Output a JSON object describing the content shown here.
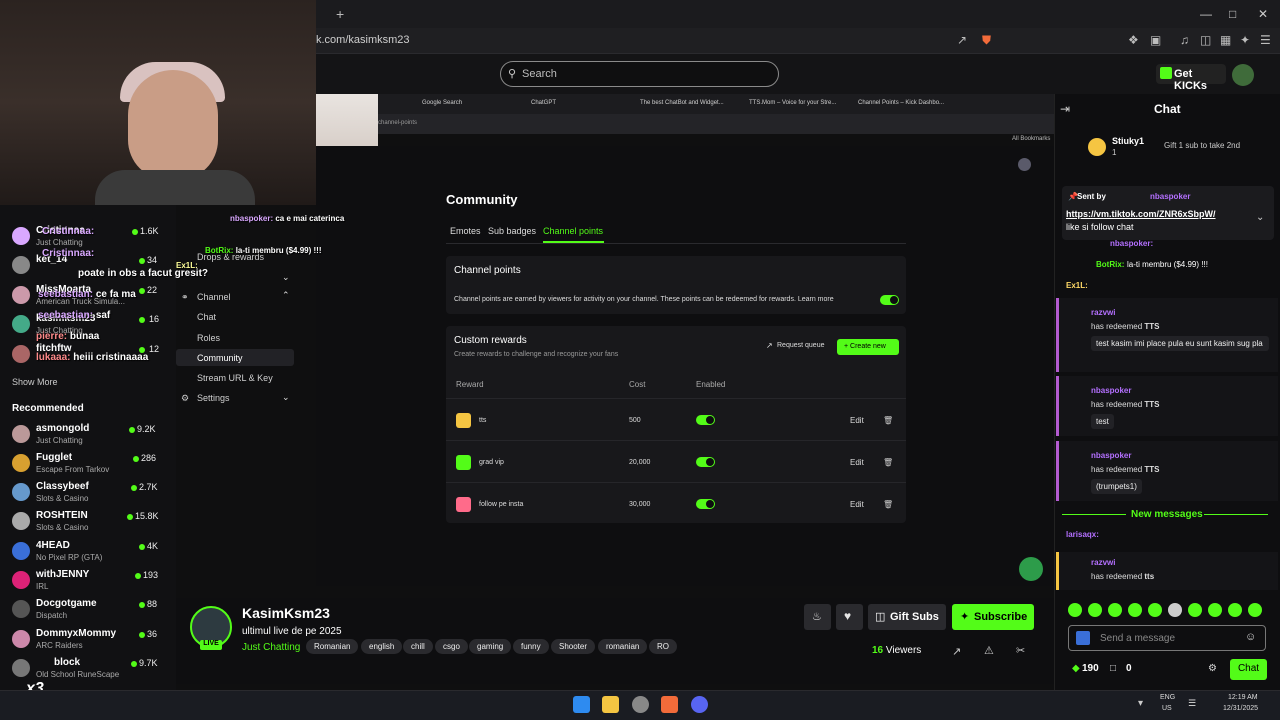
{
  "browser": {
    "url": "k.com/kasimksm23",
    "new_tab": "+"
  },
  "header": {
    "search_placeholder": "Search",
    "get_kicks": "Get KICKs"
  },
  "inner_browser": {
    "tabs": [
      "Google Search",
      "ChatGPT",
      "The best ChatBot and Widget...",
      "TTS.Mom – Voice for your Stre...",
      "Channel Points – Kick Dashbo..."
    ],
    "url": "channel-points",
    "bookmarks": "All Bookmarks"
  },
  "dashboard_sidebar": {
    "drops": "Drops & rewards",
    "channel": "Channel",
    "chat": "Chat",
    "roles": "Roles",
    "community": "Community",
    "stream_url": "Stream URL & Key",
    "settings": "Settings"
  },
  "community": {
    "title": "Community",
    "tabs": [
      "Emotes",
      "Sub badges",
      "Channel points"
    ],
    "channel_points_title": "Channel points",
    "channel_points_desc": "Channel points are earned by viewers for activity on your channel. These points can be redeemed for rewards. Learn more",
    "custom_rewards_title": "Custom rewards",
    "custom_rewards_sub": "Create rewards to challenge and recognize your fans",
    "request_queue": "Request queue",
    "create_new": "Create new",
    "col_reward": "Reward",
    "col_cost": "Cost",
    "col_enabled": "Enabled",
    "rewards": [
      {
        "name": "tts",
        "cost": "500",
        "edit": "Edit",
        "color": "#f5c542"
      },
      {
        "name": "grad vip",
        "cost": "20,000",
        "edit": "Edit",
        "color": "#53fc18"
      },
      {
        "name": "follow pe insta",
        "cost": "30,000",
        "edit": "Edit",
        "color": "#ff6b8a"
      }
    ]
  },
  "overlay_chat": [
    {
      "user": "Cristinnaa:",
      "text": "poate in obs a facut gresit?"
    },
    {
      "user": "seebastian:",
      "text": "ce fa ma"
    },
    {
      "user": "seebastian:",
      "text": "saf"
    },
    {
      "user": "pierre:",
      "text": "bunaa"
    },
    {
      "user": "lukaaa:",
      "text": "heiii cristinaaaa"
    }
  ],
  "overlay_stream_chat": [
    {
      "user": "nbaspoker:",
      "text": "ca e mai caterinca"
    },
    {
      "user": "BotRix:",
      "text": "la-ti membru ($4.99) !!!"
    },
    {
      "user": "Ex1L:",
      "text": ""
    }
  ],
  "left_sidebar": {
    "following": [
      {
        "name": "Cristinnaa",
        "category": "Just Chatting",
        "viewers": "1.6K",
        "color": "#d9a8ff"
      },
      {
        "name": "ket_14",
        "category": "",
        "viewers": "34",
        "color": "#888"
      },
      {
        "name": "MissMoarta",
        "category": "American Truck Simula...",
        "viewers": "22",
        "color": "#c9a"
      },
      {
        "name": "kasimksm23",
        "category": "Just Chatting",
        "viewers": "16",
        "color": "#4a8"
      },
      {
        "name": "fitchftw",
        "category": "",
        "viewers": "12",
        "color": "#a66"
      }
    ],
    "show_more": "Show More",
    "recommended_label": "Recommended",
    "recommended": [
      {
        "name": "asmongold",
        "category": "Just Chatting",
        "viewers": "9.2K",
        "color": "#b99"
      },
      {
        "name": "Fugglet",
        "category": "Escape From Tarkov",
        "viewers": "286",
        "color": "#d8a030"
      },
      {
        "name": "Classybeef",
        "category": "Slots & Casino",
        "viewers": "2.7K",
        "color": "#6699cc"
      },
      {
        "name": "ROSHTEIN",
        "category": "Slots & Casino",
        "viewers": "15.8K",
        "color": "#aaa"
      },
      {
        "name": "4HEAD",
        "category": "No Pixel RP (GTA)",
        "viewers": "4K",
        "color": "#3a6fd8"
      },
      {
        "name": "withJENNY",
        "category": "IRL",
        "viewers": "193",
        "color": "#d27"
      },
      {
        "name": "Docgotgame",
        "category": "Dispatch",
        "viewers": "88",
        "color": "#555"
      },
      {
        "name": "DommyxMommy",
        "category": "ARC Raiders",
        "viewers": "36",
        "color": "#c8a"
      },
      {
        "name": "block",
        "category": "Old School RuneScape",
        "viewers": "9.7K",
        "color": "#777"
      }
    ]
  },
  "stream": {
    "channel_name": "KasimKsm23",
    "live": "LIVE",
    "title": "ultimul live de pe 2025",
    "category": "Just Chatting",
    "tags": [
      "Romanian",
      "english",
      "chill",
      "csgo",
      "gaming",
      "funny",
      "Shooter",
      "romanian",
      "RO"
    ],
    "gift_subs": "Gift Subs",
    "subscribe": "Subscribe",
    "viewers_count": "16",
    "viewers_label": "Viewers"
  },
  "chat": {
    "title": "Chat",
    "top_gifter": "Stiuky1",
    "top_gifter_count": "1",
    "gift_prompt": "Gift 1 sub to take 2nd",
    "pinned_sent_by": "Sent by",
    "pinned_user": "nbaspoker",
    "pinned_link": "https://vm.tiktok.com/ZNR6xSbpW/",
    "pinned_rest": "like si follow chat",
    "messages": [
      {
        "user": "nbaspoker:",
        "text": ""
      },
      {
        "user": "BotRix:",
        "text": "la-ti membru ($4.99) !!!"
      },
      {
        "user": "Ex1L:",
        "text": ""
      }
    ],
    "redeems": [
      {
        "user": "razvwi",
        "line": "has redeemed",
        "reward": "TTS",
        "msg": "test kasim imi place pula eu sunt kasim sug pla"
      },
      {
        "user": "nbaspoker",
        "line": "has redeemed",
        "reward": "TTS",
        "msg": "test"
      },
      {
        "user": "nbaspoker",
        "line": "has redeemed",
        "reward": "TTS",
        "msg": "(trumpets1)"
      }
    ],
    "new_messages": "New messages",
    "larisa_user": "larisaqx:",
    "last_redeem_user": "razvwi",
    "last_redeem_line": "has redeemed",
    "last_redeem_reward": "tts",
    "input_placeholder": "Send a message",
    "points": "190",
    "count": "0",
    "send": "Chat"
  },
  "taskbar": {
    "lang1": "ENG",
    "lang2": "US",
    "time": "12:19 AM",
    "date": "12/31/2025"
  },
  "overlay_x3": "x3"
}
